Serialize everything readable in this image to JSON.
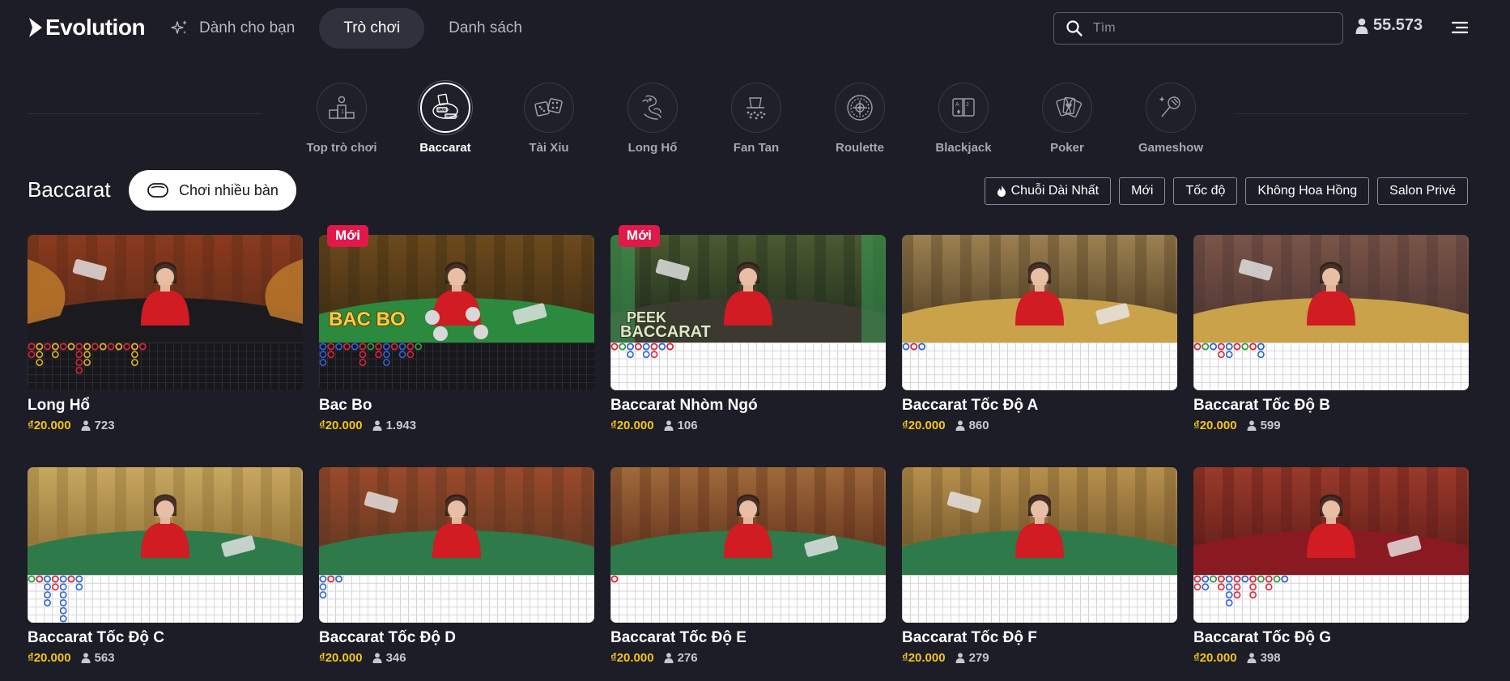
{
  "header": {
    "brand": "Evolution",
    "nav": [
      {
        "label": "Dành cho bạn",
        "icon": "sparkle-icon"
      },
      {
        "label": "Trò chơi",
        "active": true
      },
      {
        "label": "Danh sách"
      }
    ],
    "search": {
      "placeholder": "Tìm",
      "value": ""
    },
    "balance": "55.573"
  },
  "categories": [
    {
      "label": "Top trò chơi",
      "icon": "podium-icon"
    },
    {
      "label": "Baccarat",
      "icon": "baccarat-table-icon",
      "active": true
    },
    {
      "label": "Tài Xỉu",
      "icon": "dice-icon"
    },
    {
      "label": "Long Hổ",
      "icon": "dragon-tiger-icon"
    },
    {
      "label": "Fan Tan",
      "icon": "fan-tan-icon"
    },
    {
      "label": "Roulette",
      "icon": "roulette-wheel-icon"
    },
    {
      "label": "Blackjack",
      "icon": "cards-icon"
    },
    {
      "label": "Poker",
      "icon": "poker-cards-icon"
    },
    {
      "label": "Gameshow",
      "icon": "microphone-icon"
    }
  ],
  "section": {
    "title": "Baccarat",
    "multi_button": "Chơi nhiều bàn",
    "filters": [
      {
        "label": "Chuỗi Dài Nhất",
        "icon": "flame-icon"
      },
      {
        "label": "Mới"
      },
      {
        "label": "Tốc độ"
      },
      {
        "label": "Không Hoa Hồng"
      },
      {
        "label": "Salon Privé"
      }
    ]
  },
  "badge_new": "Mới",
  "games": [
    {
      "name": "Long Hổ",
      "bet": "₫20.000",
      "players": "723",
      "is_new": false,
      "road_theme": "dark",
      "logo_text": ""
    },
    {
      "name": "Bac Bo",
      "bet": "₫20.000",
      "players": "1.943",
      "is_new": true,
      "road_theme": "dark",
      "logo_text": "BAC BO"
    },
    {
      "name": "Baccarat Nhòm Ngó",
      "bet": "₫20.000",
      "players": "106",
      "is_new": true,
      "road_theme": "light",
      "logo_text": "PEEK BACCARAT"
    },
    {
      "name": "Baccarat Tốc Độ A",
      "bet": "₫20.000",
      "players": "860",
      "is_new": false,
      "road_theme": "light",
      "logo_text": ""
    },
    {
      "name": "Baccarat Tốc Độ B",
      "bet": "₫20.000",
      "players": "599",
      "is_new": false,
      "road_theme": "light",
      "logo_text": ""
    },
    {
      "name": "Baccarat Tốc Độ C",
      "bet": "₫20.000",
      "players": "563",
      "is_new": false,
      "road_theme": "light",
      "logo_text": ""
    },
    {
      "name": "Baccarat Tốc Độ D",
      "bet": "₫20.000",
      "players": "346",
      "is_new": false,
      "road_theme": "light",
      "logo_text": ""
    },
    {
      "name": "Baccarat Tốc Độ E",
      "bet": "₫20.000",
      "players": "276",
      "is_new": false,
      "road_theme": "light",
      "logo_text": ""
    },
    {
      "name": "Baccarat Tốc Độ F",
      "bet": "₫20.000",
      "players": "279",
      "is_new": false,
      "road_theme": "light",
      "logo_text": ""
    },
    {
      "name": "Baccarat Tốc Độ G",
      "bet": "₫20.000",
      "players": "398",
      "is_new": false,
      "road_theme": "light",
      "logo_text": ""
    }
  ],
  "colors": {
    "background": "#1c1d26",
    "bet_amount": "#f5c518",
    "badge_new": "#e0194a",
    "road_player": "#2d62d6",
    "road_banker": "#d8243a",
    "road_tie": "#2f9a3e",
    "road_longho_dragon": "#e0b21f",
    "road_longho_tiger": "#d8243a"
  }
}
